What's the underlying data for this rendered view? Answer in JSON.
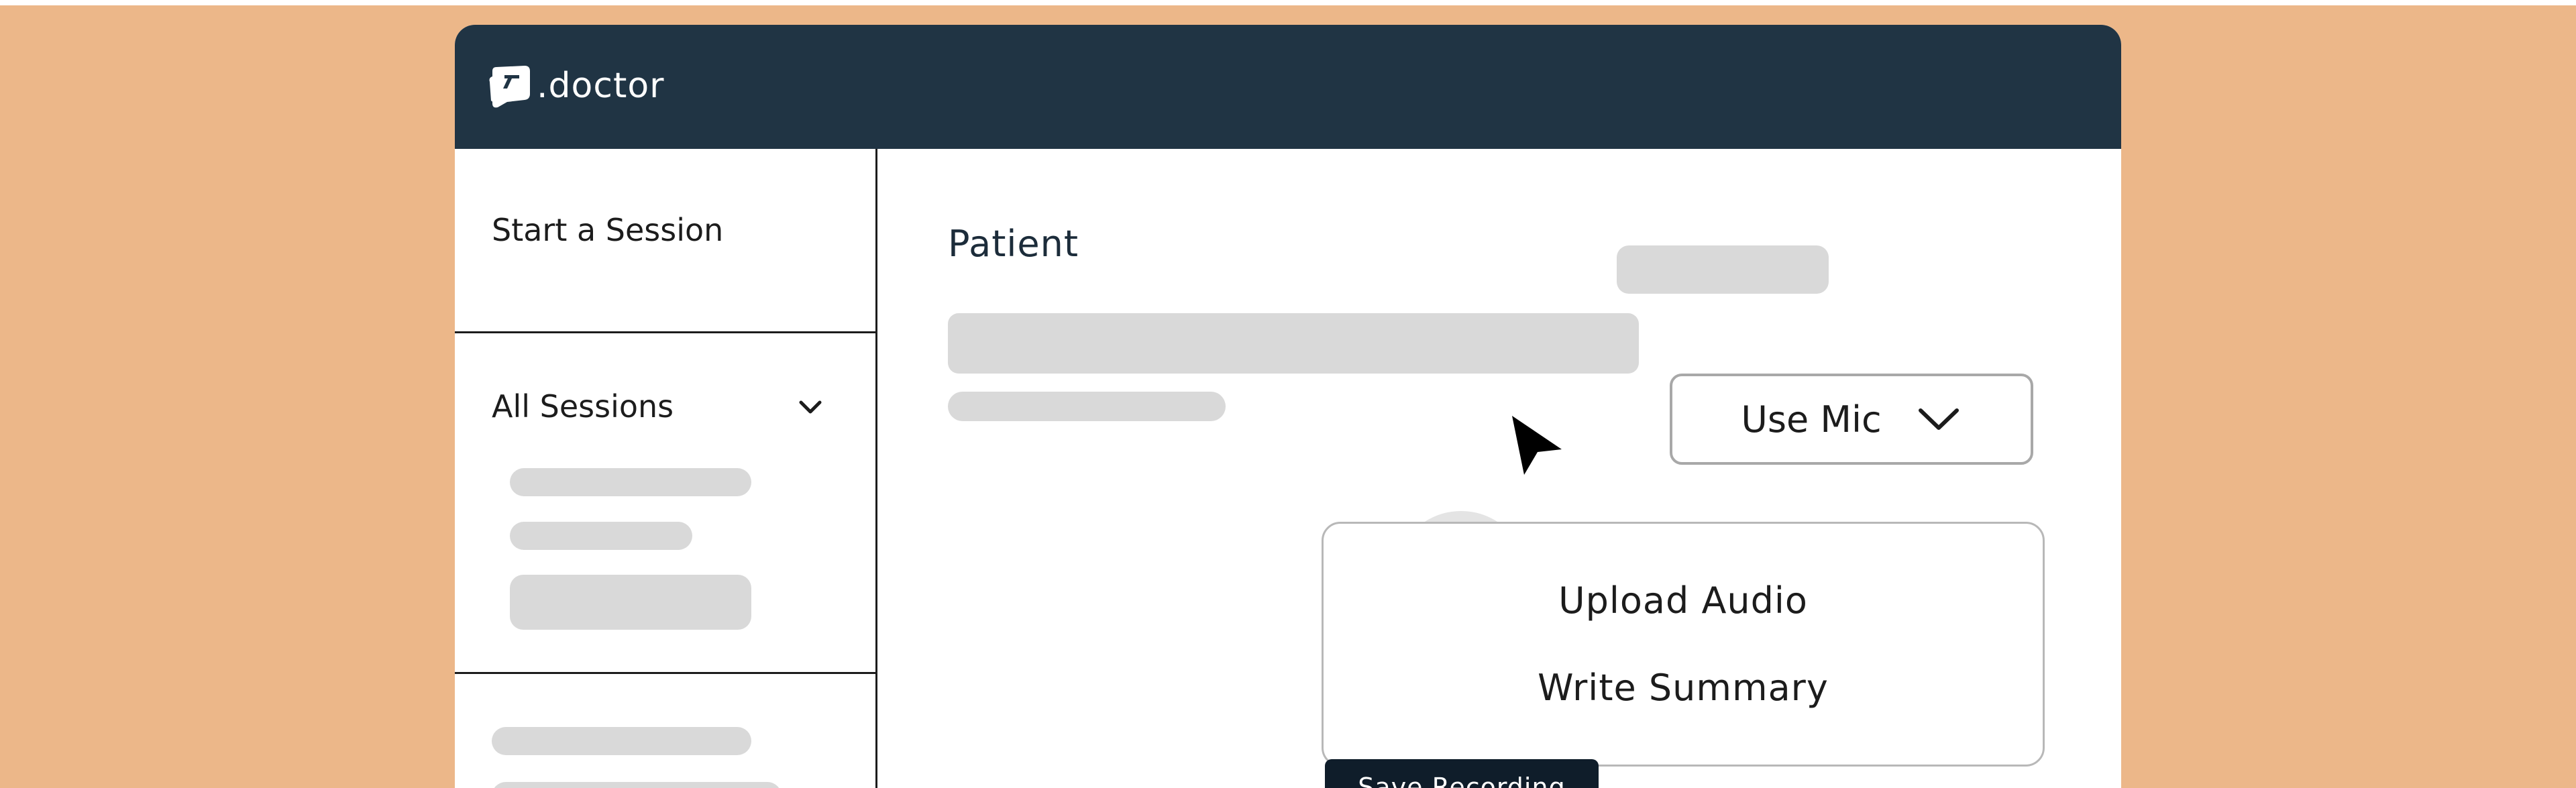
{
  "app": {
    "brand": ".doctor",
    "logo_icon": "doctor-logo-icon"
  },
  "colors": {
    "background": "#ecb789",
    "header": "#203444",
    "skeleton": "#d9d9d9",
    "save_button": "#0f1d2a"
  },
  "sidebar": {
    "start_session_label": "Start a Session",
    "all_sessions_label": "All Sessions",
    "all_sessions_icon": "chevron-down-icon"
  },
  "main": {
    "patient_label": "Patient",
    "mic_button_label": "Use Mic",
    "mic_button_icon": "chevron-down-icon",
    "dropdown_options": [
      "Upload Audio",
      "Write Summary"
    ],
    "save_button_label": "Save Recording"
  },
  "cursor": {
    "icon": "mouse-pointer-icon"
  }
}
